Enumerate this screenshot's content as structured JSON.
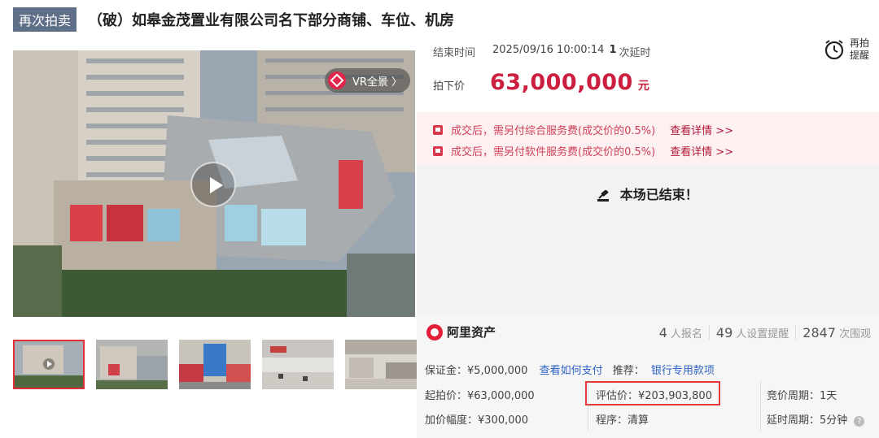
{
  "header": {
    "tag": "再次拍卖",
    "title": "（破）如皋金茂置业有限公司名下部分商铺、车位、机房"
  },
  "media": {
    "vr_label": "VR全景 〉"
  },
  "auction": {
    "end_label": "结束时间",
    "end_time": "2025/09/16 10:00:14",
    "delay_count": "1",
    "delay_text": "次延时",
    "remind_label": "再拍提醒",
    "price_label": "拍下价",
    "price": "63,000,000",
    "price_unit": "元"
  },
  "notices": [
    {
      "text": "成交后，需另付综合服务费(成交价的0.5%)",
      "link": "查看详情 >>"
    },
    {
      "text": "成交后，需另付软件服务费(成交价的0.5%)",
      "link": "查看详情 >>"
    }
  ],
  "status": {
    "ended_text": "本场已结束！"
  },
  "platform": {
    "name": "阿里资产"
  },
  "stats": {
    "signup_count": "4",
    "signup_label": "人报名",
    "remind_count": "49",
    "remind_label": "人设置提醒",
    "view_count": "2847",
    "view_label": "次围观"
  },
  "details": {
    "deposit": "保证金：¥5,000,000",
    "pay_link": "查看如何支付",
    "recommend_label": "推荐：",
    "recommend_link": "银行专用款项",
    "start_price": "起拍价：¥63,000,000",
    "appraisal": "评估价：¥203,903,800",
    "bid_period": "竞价周期：1天",
    "increment": "加价幅度：¥300,000",
    "procedure": "程序：清算",
    "delay_period": "延时周期：5分钟"
  },
  "colors": {
    "price_red": "#cc1e3e",
    "tag_bg": "#5f6f88",
    "link_blue": "#2d62c5",
    "highlight_red": "#e43c3c"
  }
}
